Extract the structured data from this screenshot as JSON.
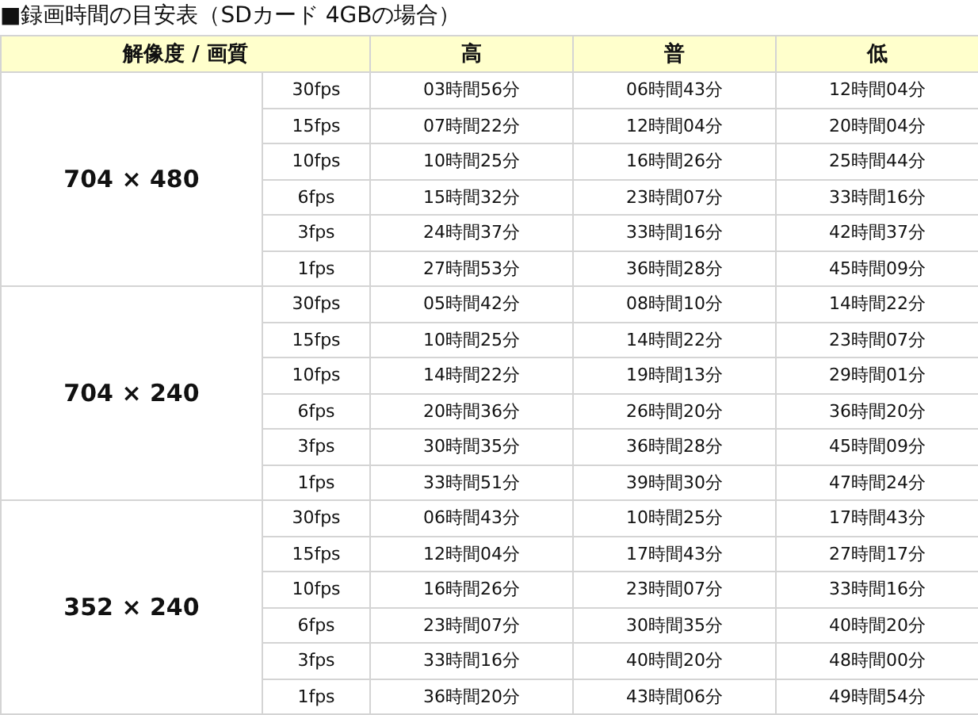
{
  "title": "■録画時間の目安表（SDカード 4GBの場合）",
  "table": {
    "columns": [
      "解像度 / 画質",
      "高",
      "普",
      "低"
    ],
    "groups": [
      {
        "resolution": "704 × 480",
        "rows": [
          {
            "fps": "30fps",
            "times": [
              "03時間56分",
              "06時間43分",
              "12時間04分"
            ]
          },
          {
            "fps": "15fps",
            "times": [
              "07時間22分",
              "12時間04分",
              "20時間04分"
            ]
          },
          {
            "fps": "10fps",
            "times": [
              "10時間25分",
              "16時間26分",
              "25時間44分"
            ]
          },
          {
            "fps": "6fps",
            "times": [
              "15時間32分",
              "23時間07分",
              "33時間16分"
            ]
          },
          {
            "fps": "3fps",
            "times": [
              "24時間37分",
              "33時間16分",
              "42時間37分"
            ]
          },
          {
            "fps": "1fps",
            "times": [
              "27時間53分",
              "36時間28分",
              "45時間09分"
            ]
          }
        ]
      },
      {
        "resolution": "704 × 240",
        "rows": [
          {
            "fps": "30fps",
            "times": [
              "05時間42分",
              "08時間10分",
              "14時間22分"
            ]
          },
          {
            "fps": "15fps",
            "times": [
              "10時間25分",
              "14時間22分",
              "23時間07分"
            ]
          },
          {
            "fps": "10fps",
            "times": [
              "14時間22分",
              "19時間13分",
              "29時間01分"
            ]
          },
          {
            "fps": "6fps",
            "times": [
              "20時間36分",
              "26時間20分",
              "36時間20分"
            ]
          },
          {
            "fps": "3fps",
            "times": [
              "30時間35分",
              "36時間28分",
              "45時間09分"
            ]
          },
          {
            "fps": "1fps",
            "times": [
              "33時間51分",
              "39時間30分",
              "47時間24分"
            ]
          }
        ]
      },
      {
        "resolution": "352 × 240",
        "rows": [
          {
            "fps": "30fps",
            "times": [
              "06時間43分",
              "10時間25分",
              "17時間43分"
            ]
          },
          {
            "fps": "15fps",
            "times": [
              "12時間04分",
              "17時間43分",
              "27時間17分"
            ]
          },
          {
            "fps": "10fps",
            "times": [
              "16時間26分",
              "23時間07分",
              "33時間16分"
            ]
          },
          {
            "fps": "6fps",
            "times": [
              "23時間07分",
              "30時間35分",
              "40時間20分"
            ]
          },
          {
            "fps": "3fps",
            "times": [
              "33時間16分",
              "40時間20分",
              "48時間00分"
            ]
          },
          {
            "fps": "1fps",
            "times": [
              "36時間20分",
              "43時間06分",
              "49時間54分"
            ]
          }
        ]
      }
    ]
  }
}
